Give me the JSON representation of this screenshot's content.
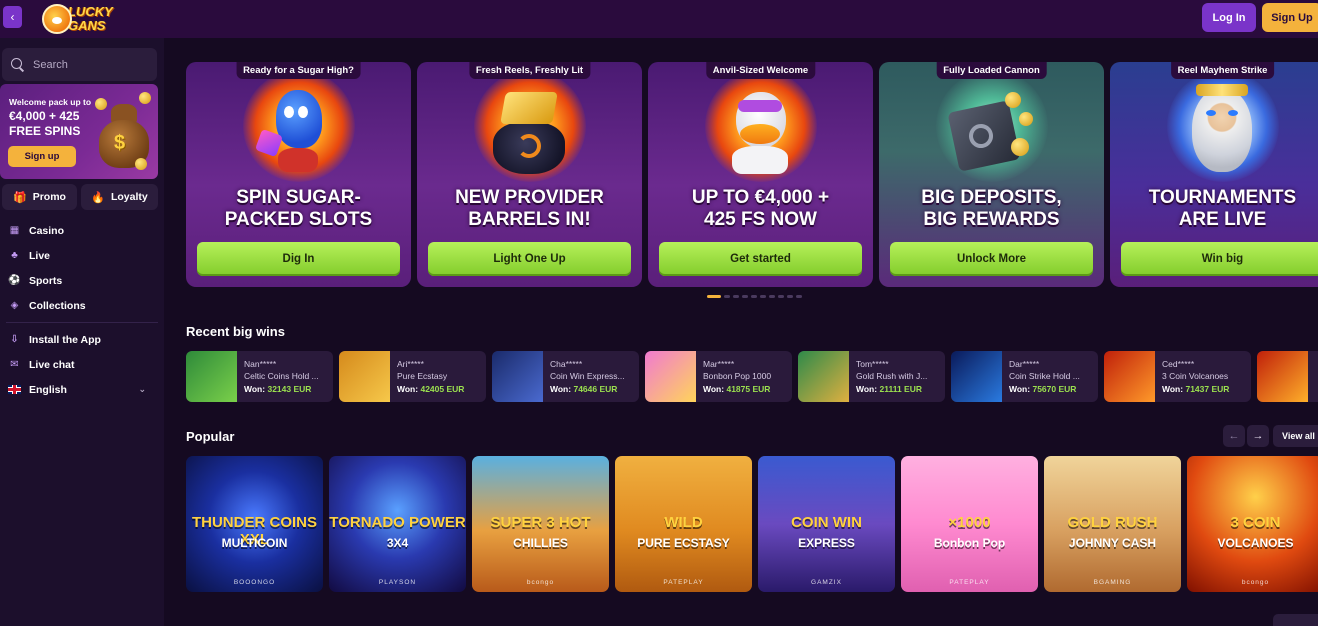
{
  "topbar": {
    "collapse_icon": "chevron-left-icon",
    "logo_line1": "LUCKY",
    "logo_line2": "GANS",
    "login_label": "Log In",
    "signup_label": "Sign Up"
  },
  "sidebar": {
    "search_placeholder": "Search",
    "promo": {
      "line1": "Welcome pack up to",
      "line2": "€4,000 + 425",
      "line3": "FREE SPINS",
      "button": "Sign up"
    },
    "pills": [
      {
        "icon": "gift-icon",
        "label": "Promo"
      },
      {
        "icon": "flame-icon",
        "label": "Loyalty"
      }
    ],
    "nav": [
      {
        "icon": "casino-icon",
        "label": "Casino"
      },
      {
        "icon": "live-icon",
        "label": "Live"
      },
      {
        "icon": "sports-icon",
        "label": "Sports"
      },
      {
        "icon": "layers-icon",
        "label": "Collections"
      }
    ],
    "nav2": [
      {
        "icon": "download-icon",
        "label": "Install the App"
      },
      {
        "icon": "chat-icon",
        "label": "Live chat"
      },
      {
        "icon": "uk-flag-icon",
        "label": "English"
      }
    ]
  },
  "banners": [
    {
      "tag": "Ready for a Sugar High?",
      "line1": "SPIN SUGAR-",
      "line2": "PACKED SLOTS",
      "cta": "Dig In"
    },
    {
      "tag": "Fresh Reels, Freshly Lit",
      "line1": "NEW PROVIDER",
      "line2": "BARRELS IN!",
      "cta": "Light One Up"
    },
    {
      "tag": "Anvil-Sized Welcome",
      "line1": "UP TO €4,000 +",
      "line2": "425 FS NOW",
      "cta": "Get started"
    },
    {
      "tag": "Fully Loaded Cannon",
      "line1": "BIG DEPOSITS,",
      "line2": "BIG REWARDS",
      "cta": "Unlock More"
    },
    {
      "tag": "Reel Mayhem Strike",
      "line1": "TOURNAMENTS",
      "line2": "ARE LIVE",
      "cta": "Win big"
    }
  ],
  "carousel": {
    "total": 10,
    "active": 0
  },
  "recent_wins": {
    "title": "Recent big wins",
    "won_label": "Won:",
    "items": [
      {
        "user": "Nan*****",
        "game": "Celtic Coins Hold ...",
        "amount": "32143 EUR"
      },
      {
        "user": "Ari*****",
        "game": "Pure Ecstasy",
        "amount": "42405 EUR"
      },
      {
        "user": "Cha*****",
        "game": "Coin Win Express...",
        "amount": "74646 EUR"
      },
      {
        "user": "Mar*****",
        "game": "Bonbon Pop 1000",
        "amount": "41875 EUR"
      },
      {
        "user": "Tom*****",
        "game": "Gold Rush with J...",
        "amount": "21111 EUR"
      },
      {
        "user": "Dar*****",
        "game": "Coin Strike Hold ...",
        "amount": "75670 EUR"
      },
      {
        "user": "Ced*****",
        "game": "3 Coin Volcanoes",
        "amount": "71437 EUR"
      }
    ]
  },
  "popular": {
    "title": "Popular",
    "prev_icon": "arrow-left-icon",
    "next_icon": "arrow-right-icon",
    "view_all": "View all",
    "games": [
      {
        "title": "THUNDER COINS XXL",
        "subtitle": "MULTICOIN",
        "provider": "BOOONGO"
      },
      {
        "title": "TORNADO POWER",
        "subtitle": "3X4",
        "provider": "PLAYSON"
      },
      {
        "title": "SUPER 3 HOT",
        "subtitle": "CHILLIES",
        "provider": "bcongo"
      },
      {
        "title": "WILD",
        "subtitle": "PURE ECSTASY",
        "provider": "PATEPLAY"
      },
      {
        "title": "COIN WIN",
        "subtitle": "EXPRESS",
        "provider": "GAMZIX"
      },
      {
        "title": "×1000",
        "subtitle": "Bonbon Pop",
        "provider": "PATEPLAY"
      },
      {
        "title": "GOLD RUSH",
        "subtitle": "JOHNNY CASH",
        "provider": "BGAMING"
      },
      {
        "title": "3 COIN",
        "subtitle": "VOLCANOES",
        "provider": "bcongo"
      }
    ]
  },
  "colors": {
    "background": "#150a21",
    "topbar": "#2a0b3d",
    "accent_purple": "#7a34c9",
    "accent_gold": "#f4b23c",
    "cta_green": "#9ee043",
    "win_green": "#9be04f"
  }
}
